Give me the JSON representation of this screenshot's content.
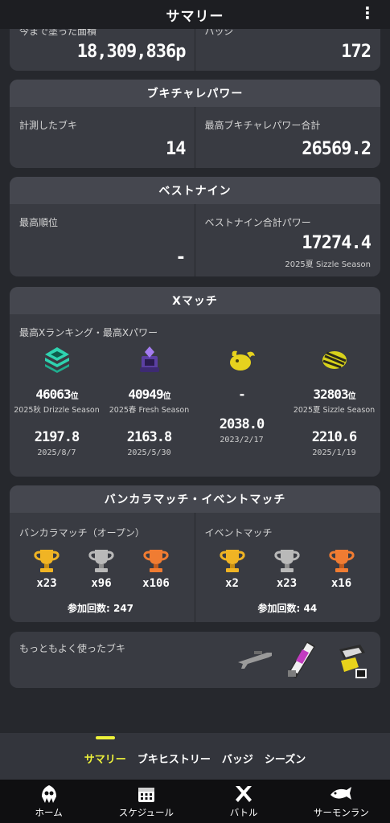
{
  "header": {
    "title": "サマリー",
    "menu": "⋮"
  },
  "paint": {
    "left_label": "今まで塗った面積",
    "left_value": "18,309,836p",
    "right_label": "バッジ",
    "right_value": "172"
  },
  "weapon_power": {
    "title": "ブキチャレパワー",
    "left_label": "計測したブキ",
    "left_value": "14",
    "right_label": "最高ブキチャレパワー合計",
    "right_value": "26569.2"
  },
  "best_nine": {
    "title": "ベストナイン",
    "left_label": "最高順位",
    "left_value": "-",
    "right_label": "ベストナイン合計パワー",
    "right_value": "17274.4",
    "right_season": "2025夏 Sizzle Season"
  },
  "xmatch": {
    "title": "Xマッチ",
    "subtitle": "最高Xランキング・最高Xパワー",
    "rank_suffix": "位",
    "columns": [
      {
        "icon": "splat-zones-icon",
        "rank": "46063",
        "season": "2025秋 Drizzle Season",
        "power": "2197.8",
        "date": "2025/8/7",
        "color": "#2fd3b0"
      },
      {
        "icon": "tower-control-icon",
        "rank": "40949",
        "season": "2025春 Fresh Season",
        "power": "2163.8",
        "date": "2025/5/30",
        "color": "#8a5fd6"
      },
      {
        "icon": "rainmaker-icon",
        "rank": "-",
        "season": "",
        "power": "2038.0",
        "date": "2023/2/17",
        "color": "#e6d21e"
      },
      {
        "icon": "clam-blitz-icon",
        "rank": "32803",
        "season": "2025夏 Sizzle Season",
        "power": "2210.6",
        "date": "2025/1/19",
        "color": "#d8d21b"
      }
    ]
  },
  "bankara": {
    "title": "バンカラマッチ・イベントマッチ",
    "left_label": "バンカラマッチ（オープン）",
    "left_trophies": [
      {
        "type": "gold-trophy-icon",
        "count": "x23"
      },
      {
        "type": "silver-trophy-icon",
        "count": "x96"
      },
      {
        "type": "bronze-trophy-icon",
        "count": "x106"
      }
    ],
    "left_participation": "参加回数: 247",
    "right_label": "イベントマッチ",
    "right_trophies": [
      {
        "type": "gold-trophy-icon",
        "count": "x2"
      },
      {
        "type": "silver-trophy-icon",
        "count": "x23"
      },
      {
        "type": "bronze-trophy-icon",
        "count": "x16"
      }
    ],
    "right_participation": "参加回数: 44"
  },
  "weapons": {
    "label": "もっともよく使ったブキ"
  },
  "tabs": {
    "summary": "サマリー",
    "weapon_history": "ブキヒストリー",
    "badges": "バッジ",
    "seasons": "シーズン"
  },
  "nav": {
    "home": "ホーム",
    "schedule": "スケジュール",
    "battle": "バトル",
    "salmon_run": "サーモンラン"
  },
  "colors": {
    "accent": "#eef23a",
    "gold": "#f0b424",
    "silver": "#b9b9b9",
    "bronze": "#f07c32"
  }
}
